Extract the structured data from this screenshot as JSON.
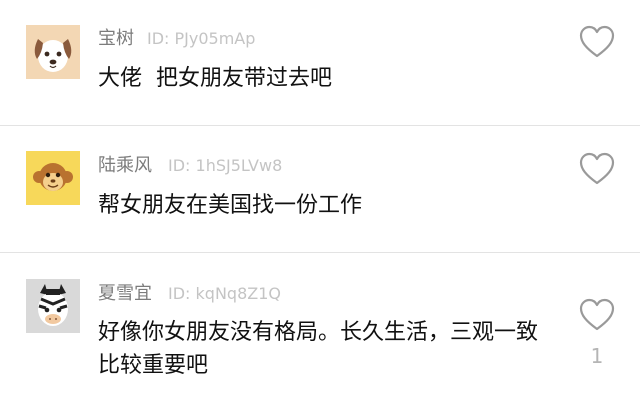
{
  "comments": [
    {
      "username": "宝树",
      "user_id": "ID: PJy05mAp",
      "text": "大佬  把女朋友带过去吧",
      "avatar_icon": "dog-avatar-icon",
      "avatar_bg": "#f3d7b4",
      "like_count": ""
    },
    {
      "username": "陆乘风",
      "user_id": "ID: 1hSJ5LVw8",
      "text": "帮女朋友在美国找一份工作",
      "avatar_icon": "monkey-avatar-icon",
      "avatar_bg": "#f7d85a",
      "like_count": ""
    },
    {
      "username": "夏雪宜",
      "user_id": "ID: kqNq8Z1Q",
      "text": "好像你女朋友没有格局。长久生活，三观一致比较重要吧",
      "avatar_icon": "zebra-avatar-icon",
      "avatar_bg": "#d9d9d9",
      "like_count": "1"
    }
  ],
  "colors": {
    "username": "#7c7c7c",
    "user_id": "#c4c4c4",
    "text": "#111111",
    "heart_outline": "#9a9a9a",
    "divider": "#e3e3e3"
  }
}
